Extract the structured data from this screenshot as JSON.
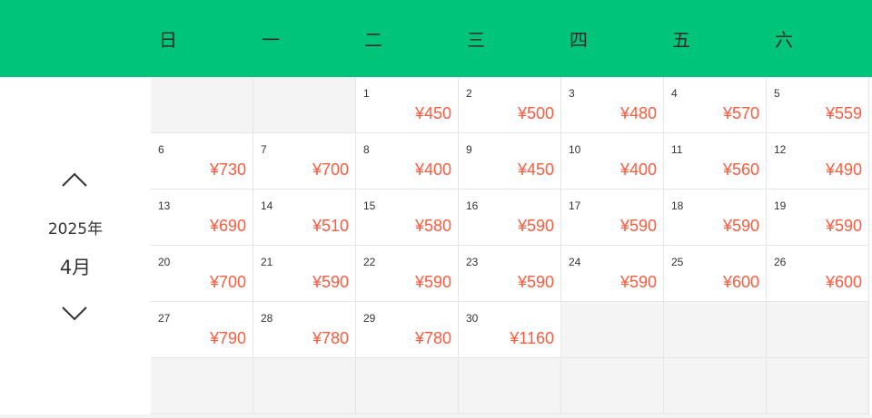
{
  "colors": {
    "header": "#00c47a",
    "price": "#ff5a3d",
    "empty_cell": "#f4f4f4"
  },
  "weekdays": [
    "日",
    "一",
    "二",
    "三",
    "四",
    "五",
    "六"
  ],
  "nav": {
    "prev_icon": "chevron-up-icon",
    "next_icon": "chevron-down-icon"
  },
  "year_label": "2025年",
  "month_label": "4月",
  "cells": [
    {
      "day": "",
      "price": ""
    },
    {
      "day": "",
      "price": ""
    },
    {
      "day": "1",
      "price": "¥450"
    },
    {
      "day": "2",
      "price": "¥500"
    },
    {
      "day": "3",
      "price": "¥480"
    },
    {
      "day": "4",
      "price": "¥570"
    },
    {
      "day": "5",
      "price": "¥559"
    },
    {
      "day": "6",
      "price": "¥730"
    },
    {
      "day": "7",
      "price": "¥700"
    },
    {
      "day": "8",
      "price": "¥400"
    },
    {
      "day": "9",
      "price": "¥450"
    },
    {
      "day": "10",
      "price": "¥400"
    },
    {
      "day": "11",
      "price": "¥560"
    },
    {
      "day": "12",
      "price": "¥490"
    },
    {
      "day": "13",
      "price": "¥690"
    },
    {
      "day": "14",
      "price": "¥510"
    },
    {
      "day": "15",
      "price": "¥580"
    },
    {
      "day": "16",
      "price": "¥590"
    },
    {
      "day": "17",
      "price": "¥590"
    },
    {
      "day": "18",
      "price": "¥590"
    },
    {
      "day": "19",
      "price": "¥590"
    },
    {
      "day": "20",
      "price": "¥700"
    },
    {
      "day": "21",
      "price": "¥590"
    },
    {
      "day": "22",
      "price": "¥590"
    },
    {
      "day": "23",
      "price": "¥590"
    },
    {
      "day": "24",
      "price": "¥590"
    },
    {
      "day": "25",
      "price": "¥600"
    },
    {
      "day": "26",
      "price": "¥600"
    },
    {
      "day": "27",
      "price": "¥790"
    },
    {
      "day": "28",
      "price": "¥780"
    },
    {
      "day": "29",
      "price": "¥780"
    },
    {
      "day": "30",
      "price": "¥1160"
    },
    {
      "day": "",
      "price": ""
    },
    {
      "day": "",
      "price": ""
    },
    {
      "day": "",
      "price": ""
    },
    {
      "day": "",
      "price": ""
    },
    {
      "day": "",
      "price": ""
    },
    {
      "day": "",
      "price": ""
    },
    {
      "day": "",
      "price": ""
    },
    {
      "day": "",
      "price": ""
    },
    {
      "day": "",
      "price": ""
    },
    {
      "day": "",
      "price": ""
    }
  ]
}
